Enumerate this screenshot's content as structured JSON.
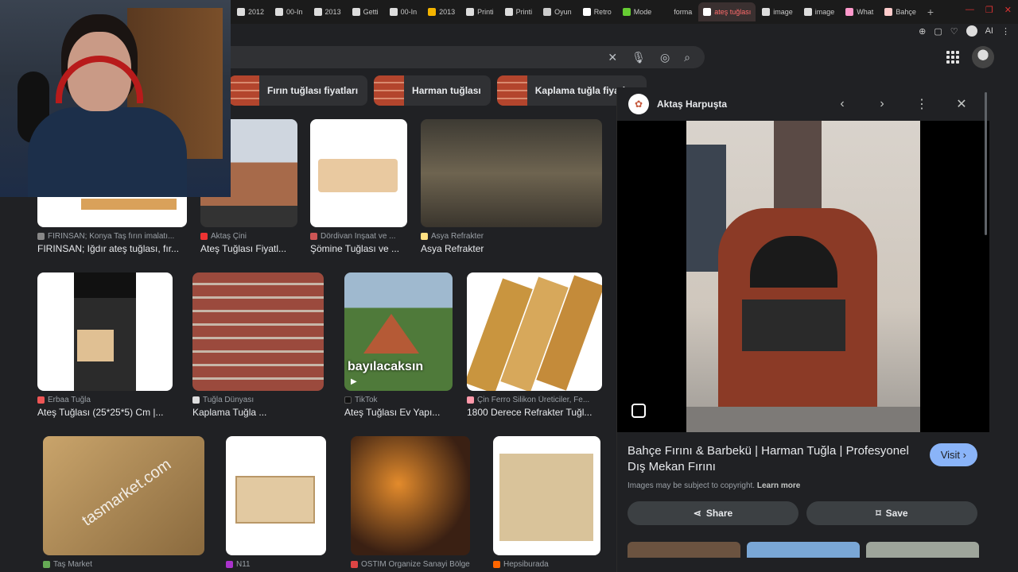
{
  "tabs": [
    {
      "label": "2012",
      "icon": "doc-icon"
    },
    {
      "label": "00-In",
      "icon": "doc-icon"
    },
    {
      "label": "2013",
      "icon": "doc-icon"
    },
    {
      "label": "Getti",
      "icon": "doc-icon"
    },
    {
      "label": "00-In",
      "icon": "doc-icon"
    },
    {
      "label": "2013",
      "icon": "drive-icon"
    },
    {
      "label": "Printi",
      "icon": "doc-icon"
    },
    {
      "label": "Printi",
      "icon": "doc-icon"
    },
    {
      "label": "Oyun",
      "icon": "web-icon"
    },
    {
      "label": "Retro",
      "icon": "retro-icon"
    },
    {
      "label": "Mode",
      "icon": "mode-icon"
    },
    {
      "label": "forma",
      "icon": "blank-icon"
    },
    {
      "label": "ateş tuğlası",
      "icon": "google-icon",
      "active": true
    },
    {
      "label": "image",
      "icon": "doc-icon"
    },
    {
      "label": "image",
      "icon": "doc-icon"
    },
    {
      "label": "What",
      "icon": "what-icon"
    },
    {
      "label": "Bahçe",
      "icon": "bahce-icon"
    }
  ],
  "extension_label": "AI",
  "chips": [
    {
      "label": "Fırın tuğlası fiyatları"
    },
    {
      "label": "Harman tuğlası"
    },
    {
      "label": "Kaplama tuğla fiyatları"
    }
  ],
  "results": [
    {
      "source": "FIRINSAN; Konya Taş fırın imalatı...",
      "title": "FIRINSAN; Iğdır ateş tuğlası, fır..."
    },
    {
      "source": "Aktaş Çini",
      "title": "Ateş Tuğlası Fiyatl..."
    },
    {
      "source": "Dördivan İnşaat ve ...",
      "title": "Şömine Tuğlası ve ..."
    },
    {
      "source": "Asya Refrakter",
      "title": "Asya Refrakter"
    },
    {
      "source": "Erbaa Tuğla",
      "title": "Ateş Tuğlası (25*25*5) Cm |..."
    },
    {
      "source": "Tuğla Dünyası",
      "title": "Kaplama Tuğla ..."
    },
    {
      "source": "TikTok",
      "title": "Ateş Tuğlası Ev Yapı...",
      "overlay": "bayılacaksın"
    },
    {
      "source": "Çin Ferro Silikon Üreticiler, Fe...",
      "title": "1800 Derece Refrakter Tuğl..."
    },
    {
      "source": "Taş Market",
      "title": "",
      "watermark": "tasmarket.com"
    },
    {
      "source": "N11",
      "title": ""
    },
    {
      "source": "OSTİM Organize Sanayi Bölgesi",
      "title": ""
    },
    {
      "source": "Hepsiburada",
      "title": ""
    }
  ],
  "panel": {
    "site": "Aktaş Harpuşta",
    "title": "Bahçe Fırını & Barbekü | Harman Tuğla | Profesyonel Dış Mekan Fırını",
    "visit_label": "Visit",
    "copyright": "Images may be subject to copyright.",
    "learn_more": "Learn more",
    "share_label": "Share",
    "save_label": "Save"
  }
}
